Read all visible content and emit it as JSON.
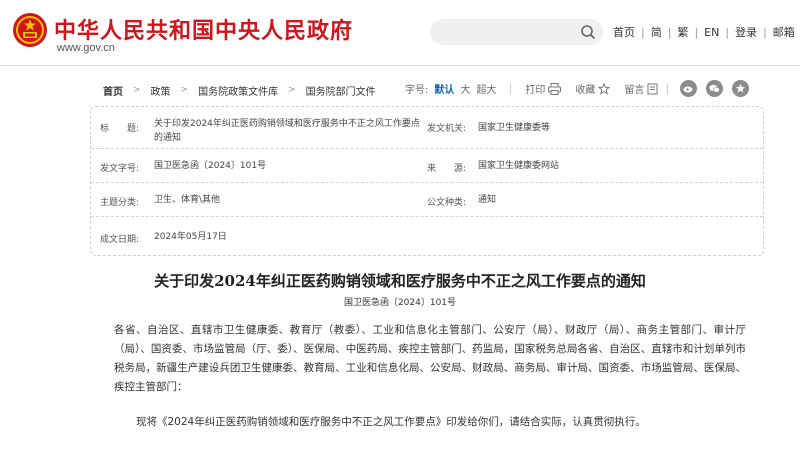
{
  "header": {
    "site_title": "中华人民共和国中央人民政府",
    "site_url": "www.gov.cn",
    "search_placeholder": "",
    "nav": [
      "首页",
      "简",
      "繁",
      "EN",
      "登录",
      "邮箱"
    ]
  },
  "breadcrumb": [
    "首页",
    "政策",
    "国务院政策文件库",
    "国务院部门文件"
  ],
  "tools": {
    "font_size_label": "字号:",
    "font_sizes": [
      "默认",
      "大",
      "超大"
    ],
    "print_label": "打印",
    "favorite_label": "收藏",
    "comment_label": "留言"
  },
  "meta": {
    "title_label": "标　　题:",
    "title_value": "关于印发2024年纠正医药购销领域和医疗服务中不正之风工作要点的通知",
    "issuer_label": "发文机关:",
    "issuer_value": "国家卫生健康委等",
    "docno_label": "发文字号:",
    "docno_value": "国卫医急函〔2024〕101号",
    "source_label": "来　　源:",
    "source_value": "国家卫生健康委网站",
    "topic_label": "主题分类:",
    "topic_value": "卫生、体育\\其他",
    "type_label": "公文种类:",
    "type_value": "通知",
    "date_label": "成文日期:",
    "date_value": "2024年05月17日"
  },
  "article": {
    "title": "关于印发2024年纠正医药购销领域和医疗服务中不正之风工作要点的通知",
    "doc_no": "国卫医急函〔2024〕101号",
    "recipients": "各省、自治区、直辖市卫生健康委、教育厅（教委）、工业和信息化主管部门、公安厅（局）、财政厅（局）、商务主管部门、审计厅（局）、国资委、市场监管局（厅、委）、医保局、中医药局、疾控主管部门、药监局，国家税务总局各省、自治区、直辖市和计划单列市税务局，新疆生产建设兵团卫生健康委、教育局、工业和信息化局、公安局、财政局、商务局、审计局、国资委、市场监管局、医保局、疾控主管部门：",
    "para1": "现将《2024年纠正医药购销领域和医疗服务中不正之风工作要点》印发给你们，请结合实际，认真贯彻执行。"
  },
  "colors": {
    "brand_red": "#d1161b",
    "accent_blue": "#0b6bbf"
  }
}
